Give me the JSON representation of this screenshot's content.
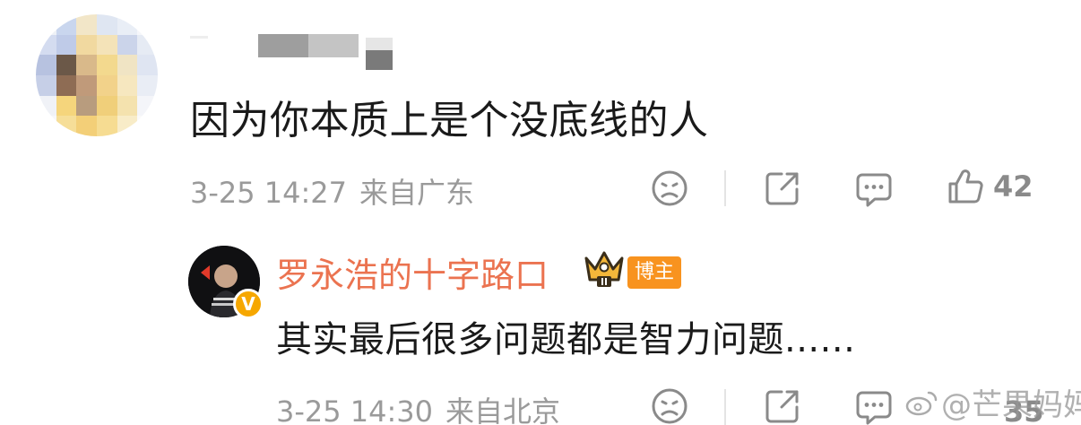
{
  "comment": {
    "text": "因为你本质上是个没底线的人",
    "time": "3-25 14:27",
    "location": "来自广东",
    "like_count": "42",
    "icons": [
      "face-icon",
      "share-icon",
      "comment-icon",
      "like-icon"
    ]
  },
  "reply": {
    "author": "罗永浩的十字路口",
    "badge_label": "博主",
    "verify_mark": "V",
    "avatar_caption": "罗永浩的十字路口",
    "text": "其实最后很多问题都是智力问题......",
    "time": "3-25 14:30",
    "location": "来自北京",
    "like_count": "35"
  },
  "watermark": {
    "text": "@芒果妈妈"
  },
  "colors": {
    "author": "#eb7350",
    "badge": "#f8931f",
    "verify": "#f6a700",
    "meta": "#9a9a9a",
    "text": "#1a1a1a"
  }
}
